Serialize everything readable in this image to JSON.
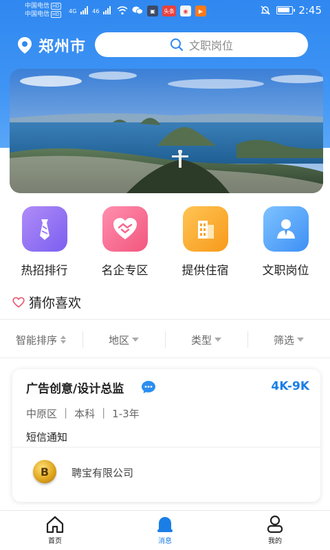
{
  "status_bar": {
    "carrier_1": "中国电信",
    "carrier_2": "中国电信",
    "hd": "HD",
    "signal_1": "4G",
    "signal_2": "46",
    "app_badge_1": "头条",
    "time": "2:45"
  },
  "header": {
    "city": "郑州市",
    "search_placeholder": "文职岗位"
  },
  "quick_categories": [
    {
      "label": "热招排行",
      "icon": "tie-icon",
      "color_from": "#b08cf7",
      "color_to": "#7b5ff0"
    },
    {
      "label": "名企专区",
      "icon": "heart-handshake-icon",
      "color_from": "#ff8fae",
      "color_to": "#f2567e"
    },
    {
      "label": "提供住宿",
      "icon": "building-icon",
      "color_from": "#ffc453",
      "color_to": "#f79a1c"
    },
    {
      "label": "文职岗位",
      "icon": "person-icon",
      "color_from": "#7ec3ff",
      "color_to": "#3d8ff5"
    }
  ],
  "section": {
    "title": "猜你喜欢"
  },
  "filters": [
    {
      "label": "智能排序",
      "icon": "sort-icon"
    },
    {
      "label": "地区",
      "icon": "chevron-down-icon"
    },
    {
      "label": "类型",
      "icon": "chevron-down-icon"
    },
    {
      "label": "筛选",
      "icon": "chevron-down-icon"
    }
  ],
  "job": {
    "title": "广告创意/设计总监",
    "salary": "4K-9K",
    "district": "中原区",
    "education": "本科",
    "experience": "1-3年",
    "notice": "短信通知",
    "company": "聘宝有限公司",
    "company_logo_letter": "B"
  },
  "nav": [
    {
      "label": "首页",
      "icon": "home-icon"
    },
    {
      "label": "消息",
      "icon": "bell-icon",
      "active": true
    },
    {
      "label": "我的",
      "icon": "user-icon"
    }
  ],
  "colors": {
    "accent": "#1a7ee6",
    "header_blue": "#2f88f0"
  }
}
